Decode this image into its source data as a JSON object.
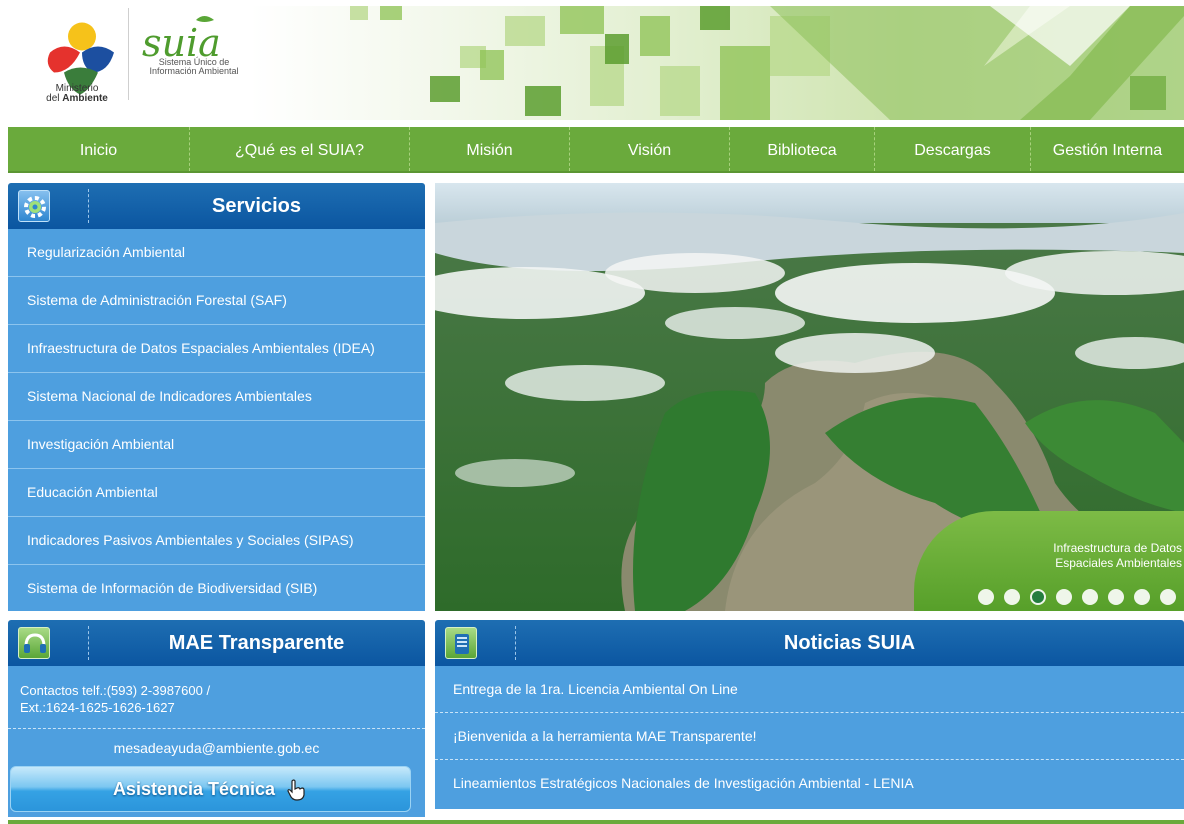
{
  "header": {
    "ministry_line1": "Ministerio",
    "ministry_line2_prefix": "del",
    "ministry_line2_bold": "Ambiente",
    "suia_logo": "suia",
    "suia_subtitle_line1": "Sistema Único de",
    "suia_subtitle_line2": "Información Ambiental"
  },
  "nav": {
    "items": [
      {
        "label": "Inicio"
      },
      {
        "label": "¿Qué es el SUIA?"
      },
      {
        "label": "Misión"
      },
      {
        "label": "Visión"
      },
      {
        "label": "Biblioteca"
      },
      {
        "label": "Descargas"
      },
      {
        "label": "Gestión Interna"
      }
    ]
  },
  "services": {
    "title": "Servicios",
    "icon": "gear-icon",
    "items": [
      {
        "label": "Regularización Ambiental"
      },
      {
        "label": "Sistema de Administración Forestal (SAF)"
      },
      {
        "label": "Infraestructura de Datos Espaciales Ambientales (IDEA)"
      },
      {
        "label": "Sistema Nacional de Indicadores Ambientales"
      },
      {
        "label": "Investigación Ambiental"
      },
      {
        "label": "Educación Ambiental"
      },
      {
        "label": "Indicadores Pasivos Ambientales y Sociales (SIPAS)"
      },
      {
        "label": "Sistema de Información de Biodiversidad (SIB)"
      }
    ]
  },
  "slider": {
    "caption_line1": "Infraestructura de Datos",
    "caption_line2": "Espaciales Ambientales",
    "dot_count": 8,
    "active_dot": 3
  },
  "mae": {
    "title": "MAE Transparente",
    "icon": "headset-icon",
    "contact_line1": "Contactos telf.:(593) 2-3987600 /",
    "contact_line2": "Ext.:1624-1625-1626-1627",
    "email": "mesadeayuda@ambiente.gob.ec",
    "button_label": "Asistencia Técnica"
  },
  "news": {
    "title": "Noticias SUIA",
    "icon": "document-icon",
    "items": [
      {
        "label": "Entrega de la 1ra. Licencia Ambiental On Line"
      },
      {
        "label": "¡Bienvenida a la herramienta MAE Transparente!"
      },
      {
        "label": "Lineamientos Estratégicos Nacionales de Investigación Ambiental - LENIA"
      }
    ]
  },
  "colors": {
    "nav_green": "#6aaa3c",
    "panel_blue": "#0b56a1",
    "list_blue": "#4e9fdf"
  }
}
